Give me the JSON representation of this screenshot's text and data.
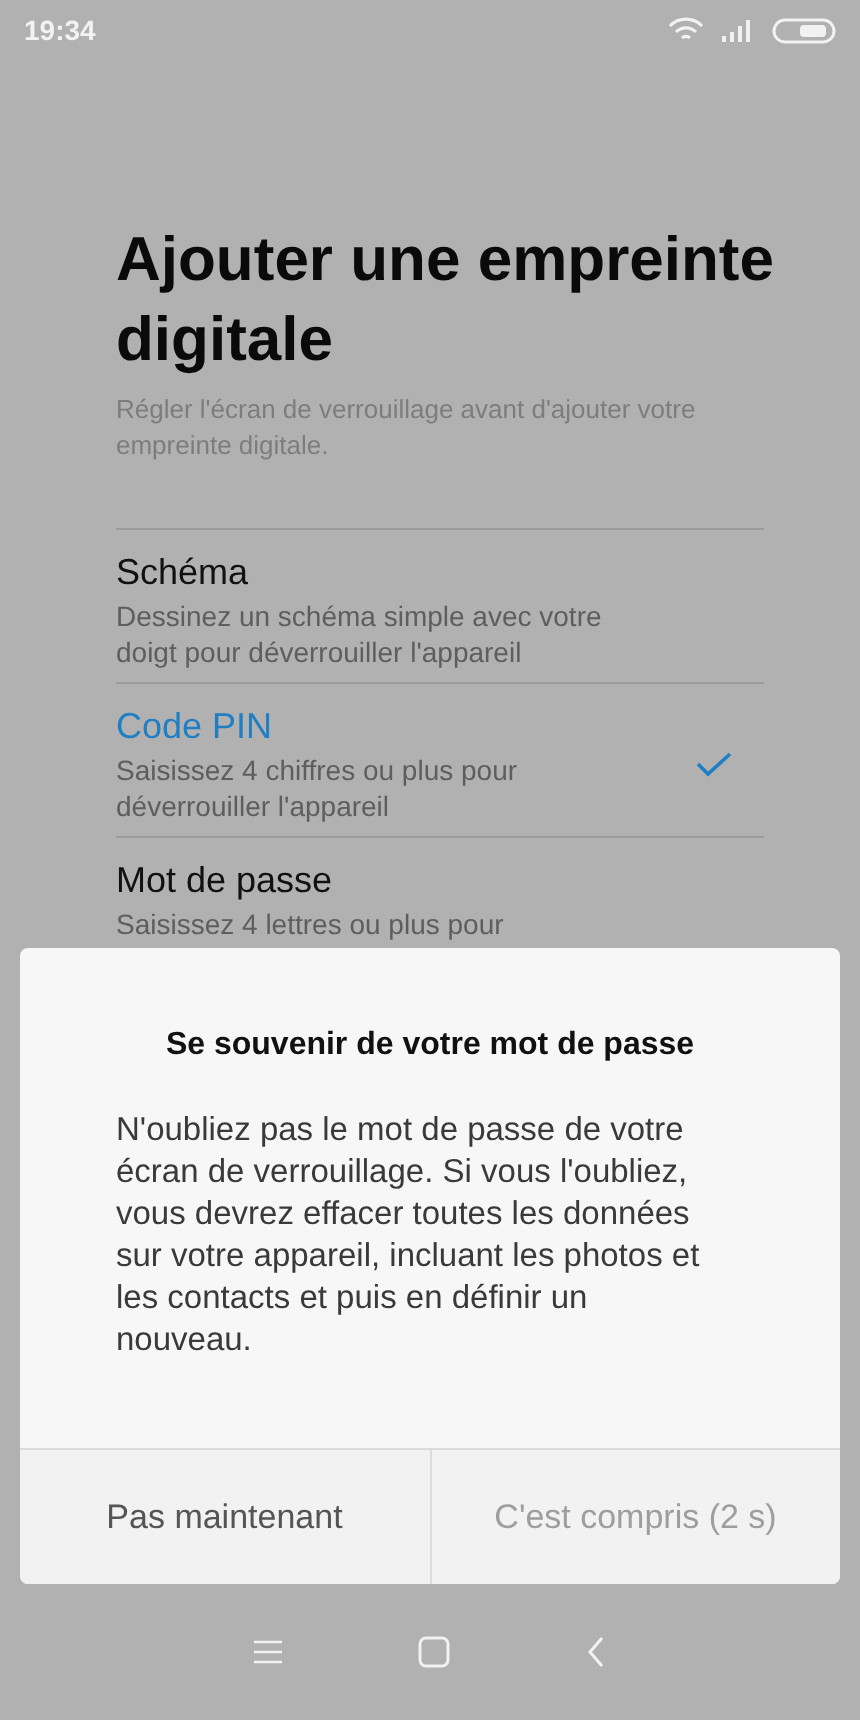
{
  "status_bar": {
    "time": "19:34"
  },
  "title": "Ajouter une empreinte digitale",
  "subtitle": "Régler l'écran de verrouillage avant d'ajouter votre empreinte digitale.",
  "options": [
    {
      "label": "Schéma",
      "description": "Dessinez un schéma simple avec votre doigt pour déverrouiller l'appareil",
      "selected": false
    },
    {
      "label": "Code PIN",
      "description": "Saisissez 4 chiffres ou plus pour déverrouiller l'appareil",
      "selected": true
    },
    {
      "label": "Mot de passe",
      "description": "Saisissez 4 lettres ou plus pour",
      "selected": false
    }
  ],
  "dialog": {
    "title": "Se souvenir de votre mot de passe",
    "message": "N'oubliez pas le mot de passe de votre écran de verrouillage. Si vous l'oubliez, vous devrez effacer toutes les données sur votre appareil, incluant les photos et les contacts et puis en définir un nouveau.",
    "buttons": [
      {
        "label": "Pas maintenant",
        "disabled": false
      },
      {
        "label": "C'est compris (2 s)",
        "disabled": true
      }
    ]
  }
}
